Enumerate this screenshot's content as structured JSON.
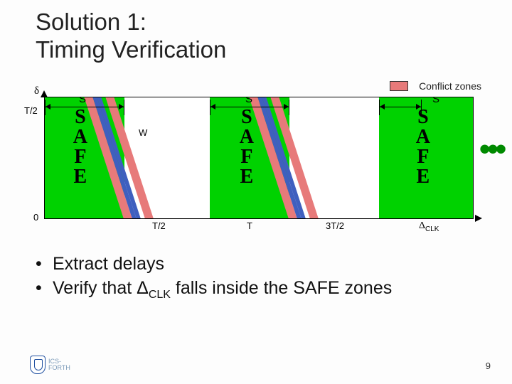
{
  "title_line1": "Solution 1:",
  "title_line2": "Timing Verification",
  "diagram": {
    "legend_label": "Conflict zones",
    "y_label": "δ",
    "y_tick_top": "T/2",
    "y_tick_bottom": "0",
    "s_label": "S",
    "w_label": "W",
    "safe_label": "SAFE",
    "x_ticks": {
      "t_half": "T/2",
      "t": "T",
      "t3_half": "3T/2"
    },
    "x_label": "Δ",
    "x_label_sub": "CLK",
    "ellipsis": "•••"
  },
  "bullets": [
    "Extract delays",
    {
      "prefix": "Verify that Δ",
      "sub": "CLK",
      "suffix": " falls inside the SAFE zones"
    }
  ],
  "footer": {
    "page_number": "9",
    "logo_line1": "ICS-",
    "logo_line2": "FORTH"
  }
}
